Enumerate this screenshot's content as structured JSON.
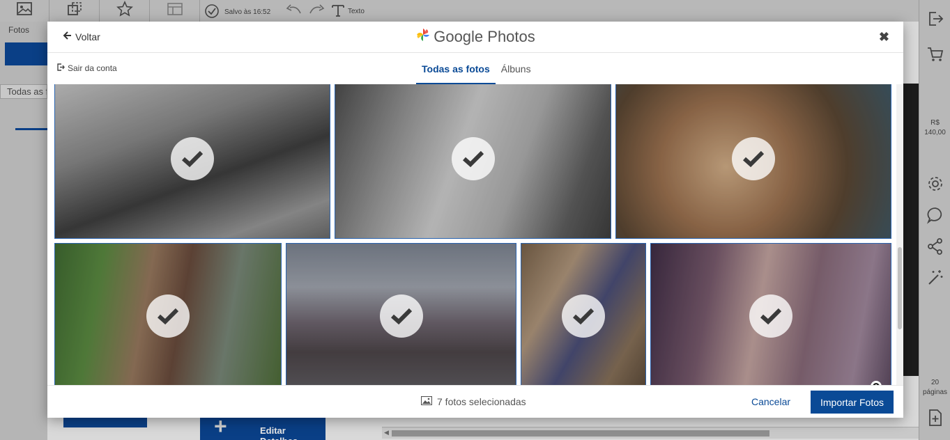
{
  "background": {
    "left_panel": {
      "fotos_label": "Fotos",
      "search_text": "Todas as f"
    },
    "toolbar": {
      "saved_text": "Salvo às 16:52",
      "text_tool_label": "Texto"
    },
    "right_panel": {
      "price_currency": "R$",
      "price_value": "140,00",
      "pages_count": "20",
      "pages_label": "páginas"
    },
    "bottom": {
      "edit_details_label": "Editar Detalhes"
    }
  },
  "modal": {
    "back_label": "Voltar",
    "title": "Google Photos",
    "logout_label": "Sair da conta",
    "tabs": [
      {
        "label": "Todas as fotos",
        "active": true
      },
      {
        "label": "Álbuns",
        "active": false
      }
    ],
    "photos": [
      {
        "description": "bw-mother-child-forest",
        "selected": true
      },
      {
        "description": "bw-father-child-hammock",
        "selected": true
      },
      {
        "description": "couple-kissing-baby-warm",
        "selected": true
      },
      {
        "description": "two-girls-flower-crowns",
        "selected": true
      },
      {
        "description": "child-dancing-street",
        "selected": true
      },
      {
        "description": "father-son-swing-autumn",
        "selected": true
      },
      {
        "description": "parents-kissing-baby",
        "selected": true
      }
    ],
    "selected_count_text": "7 fotos selecionadas",
    "cancel_label": "Cancelar",
    "import_label": "Importar Fotos"
  },
  "colors": {
    "accent": "#0a4a96",
    "photo_border": "#2a64b0"
  }
}
